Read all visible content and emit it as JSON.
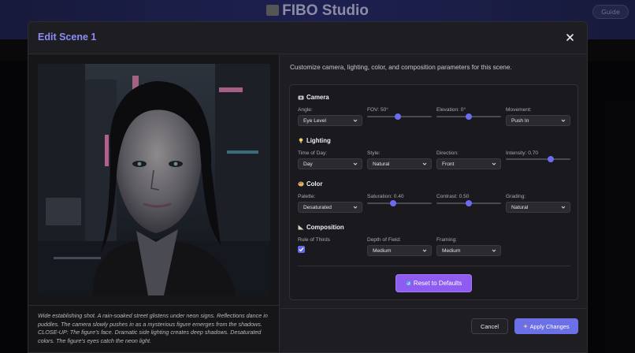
{
  "app": {
    "title": "FIBO Studio",
    "guide_label": "Guide"
  },
  "modal": {
    "title": "Edit Scene 1",
    "intro": "Customize camera, lighting, color, and composition parameters for this scene.",
    "description": "Wide establishing shot. A rain-soaked street glistens under neon signs. Reflections dance in puddles. The camera slowly pushes in as a mysterious figure emerges from the shadows. CLOSE-UP: The figure's face. Dramatic side lighting creates deep shadows. Desaturated colors. The figure's eyes catch the neon light."
  },
  "camera": {
    "title": "Camera",
    "angle_label": "Angle:",
    "angle_value": "Eye Level",
    "fov_label": "FOV: 50°",
    "fov_fraction": 0.47,
    "elevation_label": "Elevation: 0°",
    "elevation_fraction": 0.5,
    "movement_label": "Movement:",
    "movement_value": "Push In"
  },
  "lighting": {
    "title": "Lighting",
    "time_label": "Time of Day:",
    "time_value": "Day",
    "style_label": "Style:",
    "style_value": "Natural",
    "direction_label": "Direction:",
    "direction_value": "Front",
    "intensity_label": "Intensity: 0.70",
    "intensity_fraction": 0.7
  },
  "color": {
    "title": "Color",
    "palette_label": "Palette:",
    "palette_value": "Desaturated",
    "saturation_label": "Saturation: 0.40",
    "saturation_fraction": 0.4,
    "contrast_label": "Contrast: 0.50",
    "contrast_fraction": 0.5,
    "grading_label": "Grading:",
    "grading_value": "Natural"
  },
  "composition": {
    "title": "Composition",
    "rule_label": "Rule of Thirds",
    "rule_checked": true,
    "dof_label": "Depth of Field:",
    "dof_value": "Medium",
    "framing_label": "Framing:",
    "framing_value": "Medium"
  },
  "buttons": {
    "reset": "Reset to Defaults",
    "cancel": "Cancel",
    "apply": "Apply Changes"
  },
  "colors": {
    "accent": "#6c6cf0",
    "title": "#8b8cf4",
    "reset_bg": "#8e5cf0",
    "apply_bg": "#6c70e6"
  }
}
